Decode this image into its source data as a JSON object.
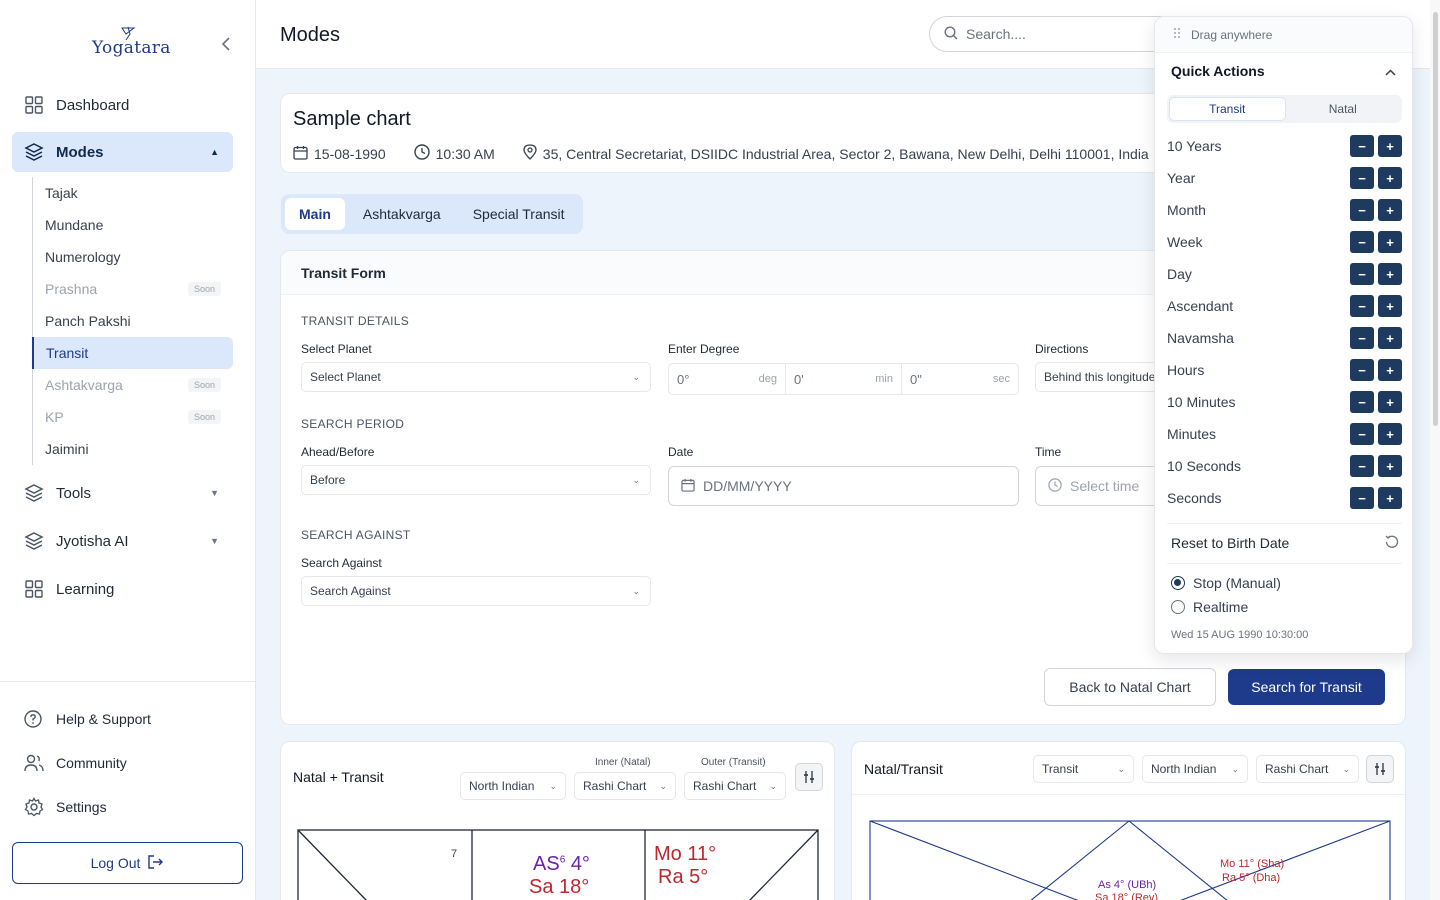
{
  "brand": {
    "name": "Yogatara"
  },
  "sidebar": {
    "items": [
      {
        "label": "Dashboard",
        "icon": "grid-icon"
      },
      {
        "label": "Modes",
        "icon": "layers-icon"
      },
      {
        "label": "Tools",
        "icon": "layers-icon"
      },
      {
        "label": "Jyotisha AI",
        "icon": "layers-icon"
      },
      {
        "label": "Learning",
        "icon": "grid-icon"
      }
    ],
    "modes_sub": [
      {
        "label": "Tajak"
      },
      {
        "label": "Mundane"
      },
      {
        "label": "Numerology"
      },
      {
        "label": "Prashna",
        "badge": "Soon"
      },
      {
        "label": "Panch Pakshi"
      },
      {
        "label": "Transit"
      },
      {
        "label": "Ashtakvarga",
        "badge": "Soon"
      },
      {
        "label": "KP",
        "badge": "Soon"
      },
      {
        "label": "Jaimini"
      }
    ],
    "bottom": [
      {
        "label": "Help & Support"
      },
      {
        "label": "Community"
      },
      {
        "label": "Settings"
      }
    ],
    "logout_label": "Log Out"
  },
  "header": {
    "title": "Modes",
    "search_placeholder": "Search...."
  },
  "chart_info": {
    "name": "Sample chart",
    "date": "15-08-1990",
    "time": "10:30 AM",
    "location": "35, Central Secretariat, DSIIDC Industrial Area, Sector 2, Bawana, New Delhi, Delhi 110001, India"
  },
  "tabs": [
    "Main",
    "Ashtakvarga",
    "Special Transit"
  ],
  "transit_form": {
    "title": "Transit Form",
    "section_details": "TRANSIT DETAILS",
    "select_planet_label": "Select Planet",
    "select_planet_value": "Select Planet",
    "enter_degree_label": "Enter Degree",
    "deg_value": "0°",
    "deg_unit": "deg",
    "min_value": "0'",
    "min_unit": "min",
    "sec_value": "0\"",
    "sec_unit": "sec",
    "directions_label": "Directions",
    "directions_value": "Behind this longitude",
    "section_period": "SEARCH PERIOD",
    "ahead_label": "Ahead/Before",
    "ahead_value": "Before",
    "date_label": "Date",
    "date_placeholder": "DD/MM/YYYY",
    "time_label": "Time",
    "time_placeholder": "Select time",
    "section_against": "SEARCH AGAINST",
    "against_label": "Search Against",
    "against_value": "Search Against",
    "back_button": "Back to Natal Chart",
    "search_button": "Search for Transit"
  },
  "natal_transit": {
    "title": "Natal + Transit",
    "inner_label": "Inner (Natal)",
    "outer_label": "Outer (Transit)",
    "style_value": "North Indian",
    "inner_value": "Rashi Chart",
    "outer_value": "Rashi Chart",
    "house_num_7": "7",
    "house_num_6": "6",
    "as_label": "AS",
    "as_deg": "4°",
    "sa_label": "Sa 18°",
    "mo_label": "Mo 11°",
    "ra_label": "Ra 5°"
  },
  "natal_slash_transit": {
    "title": "Natal/Transit",
    "mode_value": "Transit",
    "style_value": "North Indian",
    "chart_value": "Rashi Chart",
    "mo_label": "Mo 11° (Sha)",
    "ra_label": "Ra 5° (Dha)",
    "as_label": "As 4° (UBh)",
    "sa_label": "Sa 18° (Rev)"
  },
  "quick_actions": {
    "drag_label": "Drag anywhere",
    "title": "Quick Actions",
    "toggle": [
      "Transit",
      "Natal"
    ],
    "rows": [
      "10 Years",
      "Year",
      "Month",
      "Week",
      "Day",
      "Ascendant",
      "Navamsha",
      "Hours",
      "10 Minutes",
      "Minutes",
      "10 Seconds",
      "Seconds"
    ],
    "minus": "−",
    "plus": "+",
    "reset_label": "Reset to Birth Date",
    "radio_manual": "Stop (Manual)",
    "radio_realtime": "Realtime",
    "timestamp": "Wed 15 AUG 1990 10:30:00"
  },
  "colors": {
    "primary": "#1e3a8a",
    "active_bg": "#dbe8fb",
    "page_bg": "#eef4fc",
    "planet_red": "#c0262d",
    "planet_purple": "#6b21a8"
  }
}
